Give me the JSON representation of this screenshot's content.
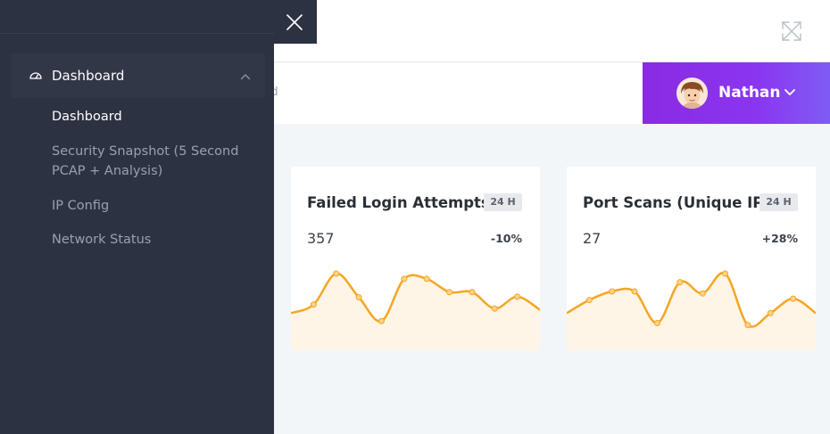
{
  "header": {
    "breadcrumb_fragment": "rd"
  },
  "user": {
    "name": "Nathan"
  },
  "sidebar": {
    "parent": {
      "label": "Dashboard",
      "icon": "dashboard-gauge-icon"
    },
    "items": [
      {
        "label": "Dashboard",
        "active": true
      },
      {
        "label": "Security Snapshot (5 Second PCAP + Analysis)",
        "active": false
      },
      {
        "label": "IP Config",
        "active": false
      },
      {
        "label": "Network Status",
        "active": false
      }
    ]
  },
  "cards": [
    {
      "title": "Failed Login Attempts",
      "badge": "24 H",
      "value": "357",
      "change": "-10%",
      "sparkline": [
        40,
        53,
        100,
        64,
        28,
        92,
        92,
        72,
        72,
        47,
        65,
        45
      ]
    },
    {
      "title": "Port Scans (Unique IPs)",
      "badge": "24 H",
      "value": "27",
      "change": "+28%",
      "sparkline": [
        40,
        60,
        73,
        73,
        25,
        87,
        70,
        100,
        22,
        40,
        62,
        40
      ]
    }
  ],
  "colors": {
    "sidebar_bg": "#2d3242",
    "user_panel_gradient_start": "#8a2be2",
    "user_panel_gradient_end": "#7f5cf3",
    "sparkline_stroke": "#f5a623",
    "sparkline_fill": "#fff5e6"
  }
}
